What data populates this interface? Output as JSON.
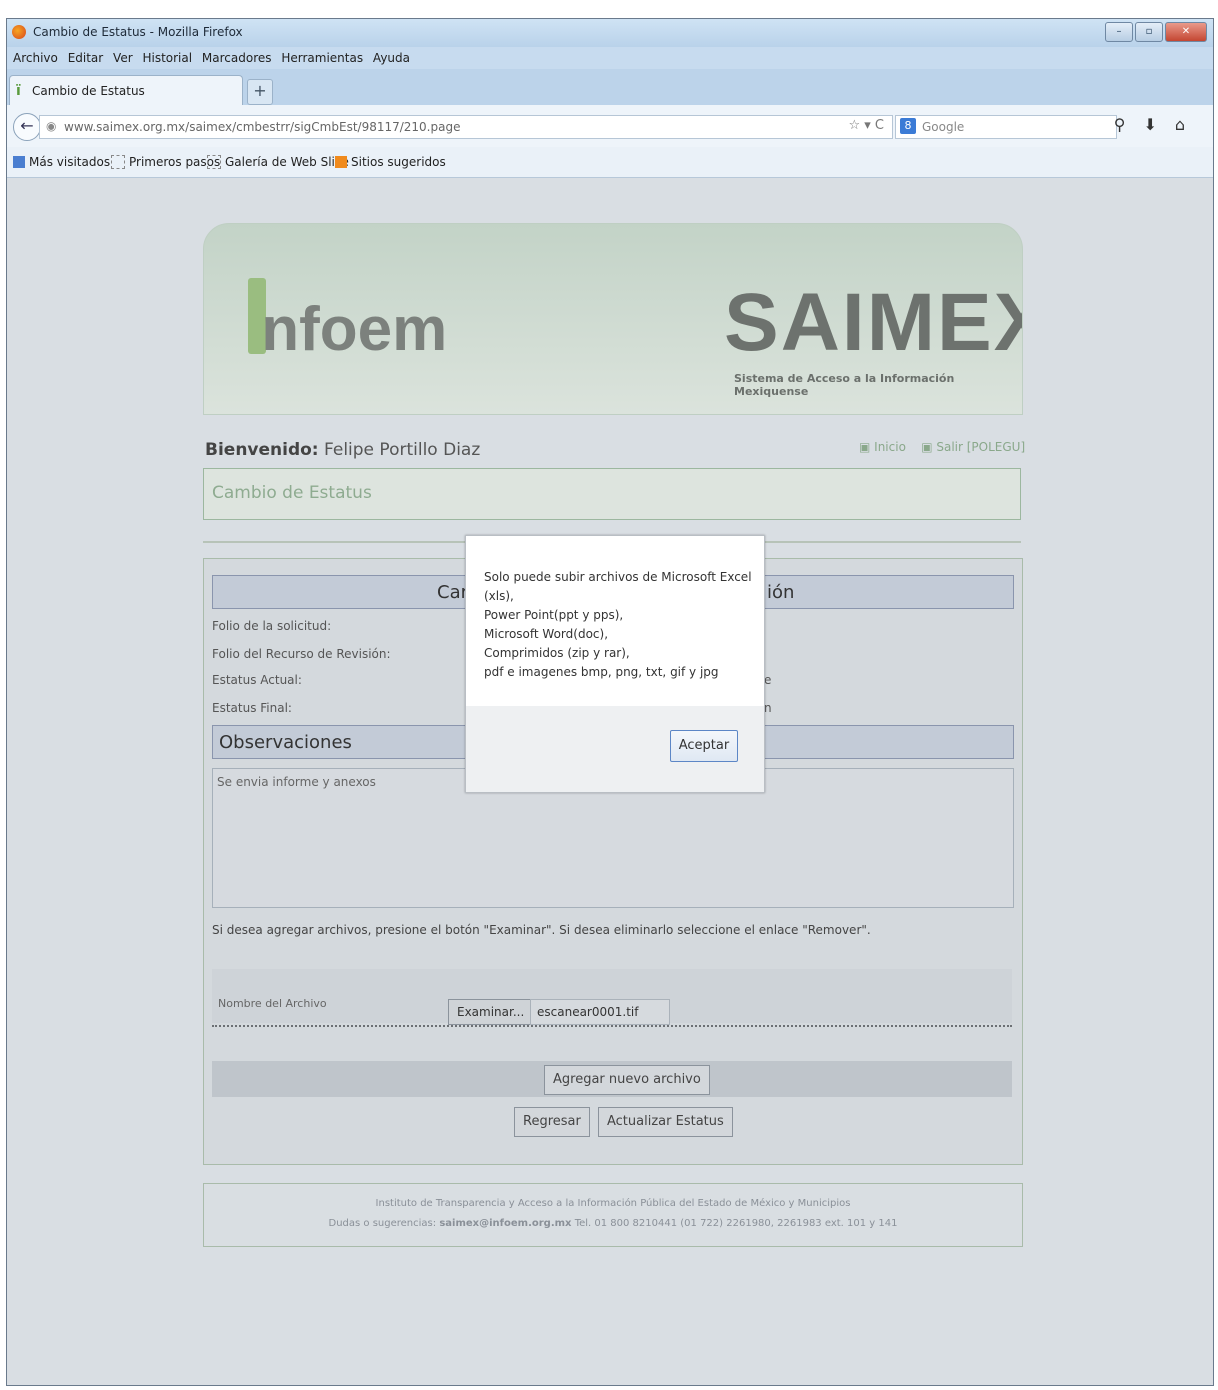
{
  "window": {
    "title": "Cambio de Estatus - Mozilla Firefox"
  },
  "menu": [
    "Archivo",
    "Editar",
    "Ver",
    "Historial",
    "Marcadores",
    "Herramientas",
    "Ayuda"
  ],
  "tab": {
    "label": "Cambio de Estatus"
  },
  "nav": {
    "url": "www.saimex.org.mx/saimex/cmbestrr/sigCmbEst/98117/210.page",
    "search_placeholder": "Google"
  },
  "bookmarks": [
    "Más visitados",
    "Primeros pasos",
    "Galería de Web Slice",
    "Sitios sugeridos"
  ],
  "header": {
    "logo_left": "nfoem",
    "logo_right": "SAIMEX",
    "subtitle": "Sistema de Acceso a la Información Mexiquense"
  },
  "welcome": {
    "prefix": "Bienvenido:",
    "name": "Felipe Portillo Diaz"
  },
  "links": {
    "inicio": "Inicio",
    "salir": "Salir [POLEGU]"
  },
  "page": {
    "status_title": "Cambio de Estatus"
  },
  "form": {
    "section_title_left": "Car",
    "section_title_right": "ión",
    "fields": [
      {
        "label": "Folio de la solicitud:",
        "tail": ""
      },
      {
        "label": "Folio del Recurso de Revisión:",
        "tail": ""
      },
      {
        "label": "Estatus Actual:",
        "tail": "e"
      },
      {
        "label": "Estatus Final:",
        "tail": "n"
      }
    ],
    "observaciones_title": "Observaciones",
    "observaciones_text": "Se envia informe y anexos",
    "hint": "Si desea agregar archivos, presione el botón \"Examinar\". Si desea eliminarlo seleccione el enlace \"Remover\".",
    "file_label": "Nombre del Archivo",
    "examinar": "Examinar...",
    "file_name": "escanear0001.tif",
    "add_file": "Agregar nuevo archivo",
    "regresar": "Regresar",
    "actualizar": "Actualizar Estatus"
  },
  "footer": {
    "line1": "Instituto de Transparencia y Acceso a la Información Pública del Estado de México y Municipios",
    "line2_prefix": "Dudas o sugerencias:",
    "line2_email": "saimex@infoem.org.mx",
    "line2_rest": "Tel. 01 800 8210441 (01 722) 2261980, 2261983 ext. 101 y 141"
  },
  "dialog": {
    "lines": [
      "Solo puede subir archivos de Microsoft Excel (xls),",
      "Power Point(ppt y pps),",
      "Microsoft Word(doc),",
      "Comprimidos (zip y rar),",
      "pdf e imagenes bmp, png, txt, gif y jpg"
    ],
    "button": "Aceptar"
  }
}
